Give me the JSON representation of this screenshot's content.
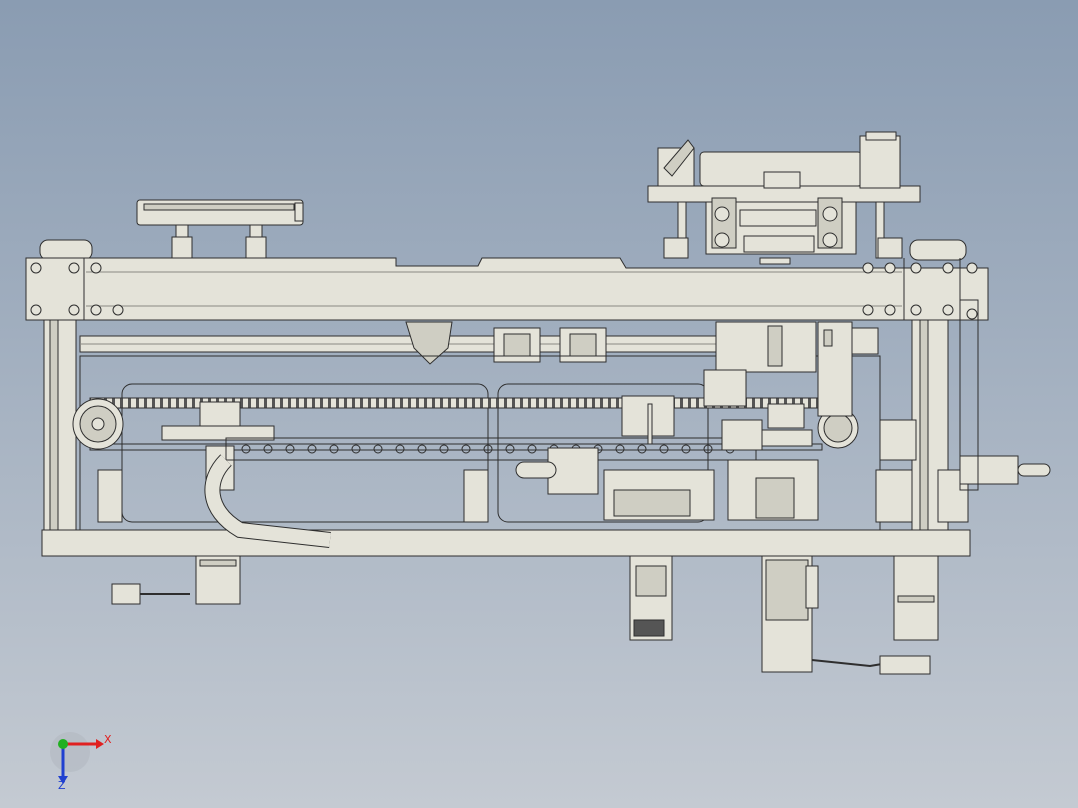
{
  "viewport": {
    "background_top": "#8a9cb2",
    "background_bottom": "#c4cad2"
  },
  "model": {
    "part_fill": "#e4e3d9",
    "part_fill_dark": "#cfcec3",
    "edge_color": "#2e2e2e",
    "view": "front"
  },
  "triad": {
    "x_label": "X",
    "z_label": "Z",
    "x_color": "#e02020",
    "y_color": "#20b020",
    "z_color": "#2040d0"
  }
}
